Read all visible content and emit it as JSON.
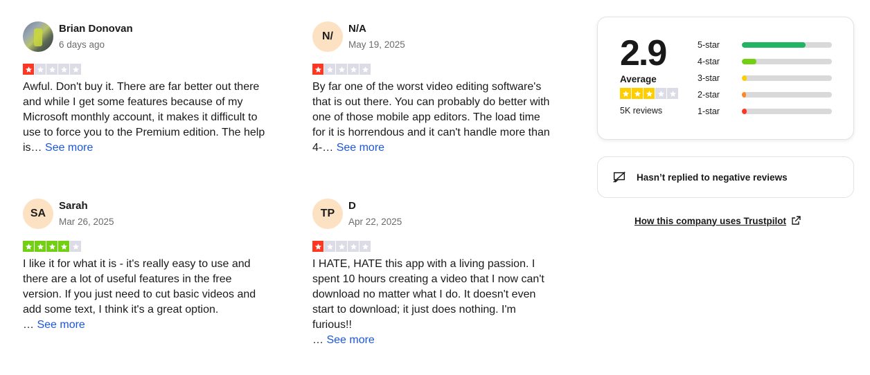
{
  "reviews": [
    {
      "name": "Brian Donovan",
      "date": "6 days ago",
      "avatar": "photo",
      "initials": "",
      "rating": 1,
      "text": "Awful. Don't buy it. There are far better out there and while I get some features because of my Microsoft monthly account, it makes it difficult to use to force you to the Premium edition. The help is…",
      "see_more": "See more"
    },
    {
      "name": "N/A",
      "date": "May 19, 2025",
      "avatar": "initials",
      "initials": "N/",
      "rating": 1,
      "text": "By far one of the worst video editing software's that is out there. You can probably do better with one of those mobile app editors. The load time for it is horrendous and it can't handle more than 4-…",
      "see_more": "See more"
    },
    {
      "name": "Sarah",
      "date": "Mar 26, 2025",
      "avatar": "initials",
      "initials": "SA",
      "rating": 4,
      "text": "I like it for what it is - it's really easy to use and there are a lot of useful features in the free version. If you just need to cut basic videos and add some text, I think it's a great option.",
      "text_tail": "…",
      "see_more": "See more"
    },
    {
      "name": "D",
      "date": "Apr 22, 2025",
      "avatar": "initials",
      "initials": "TP",
      "rating": 1,
      "text": "I HATE, HATE this app with a living passion. I spent 10 hours creating a video that I now can't download no matter what I do. It doesn't even start to download; it just does nothing. I'm furious!!",
      "text_tail": "…",
      "see_more": "See more"
    }
  ],
  "summary": {
    "score": "2.9",
    "label": "Average",
    "rating_stars": 3,
    "review_count": "5K reviews",
    "breakdown": [
      {
        "label": "5-star",
        "fraction": 0.71,
        "color": "#22b364"
      },
      {
        "label": "4-star",
        "fraction": 0.16,
        "color": "#73cf11"
      },
      {
        "label": "3-star",
        "fraction": 0.05,
        "color": "#ffce00"
      },
      {
        "label": "2-star",
        "fraction": 0.03,
        "color": "#ff8622"
      },
      {
        "label": "1-star",
        "fraction": 0.05,
        "color": "#ff3722"
      }
    ]
  },
  "reply_notice": {
    "text": "Hasn’t replied to negative reviews",
    "icon": "speech-bubble-icon"
  },
  "trust_link": {
    "text": "How this company uses Trustpilot",
    "icon": "external-link-icon"
  },
  "colors": {
    "star_empty": "#dcdce6",
    "star_1": "#ff3722",
    "star_3": "#ffce00",
    "star_4": "#73cf11",
    "link": "#1a56db"
  }
}
